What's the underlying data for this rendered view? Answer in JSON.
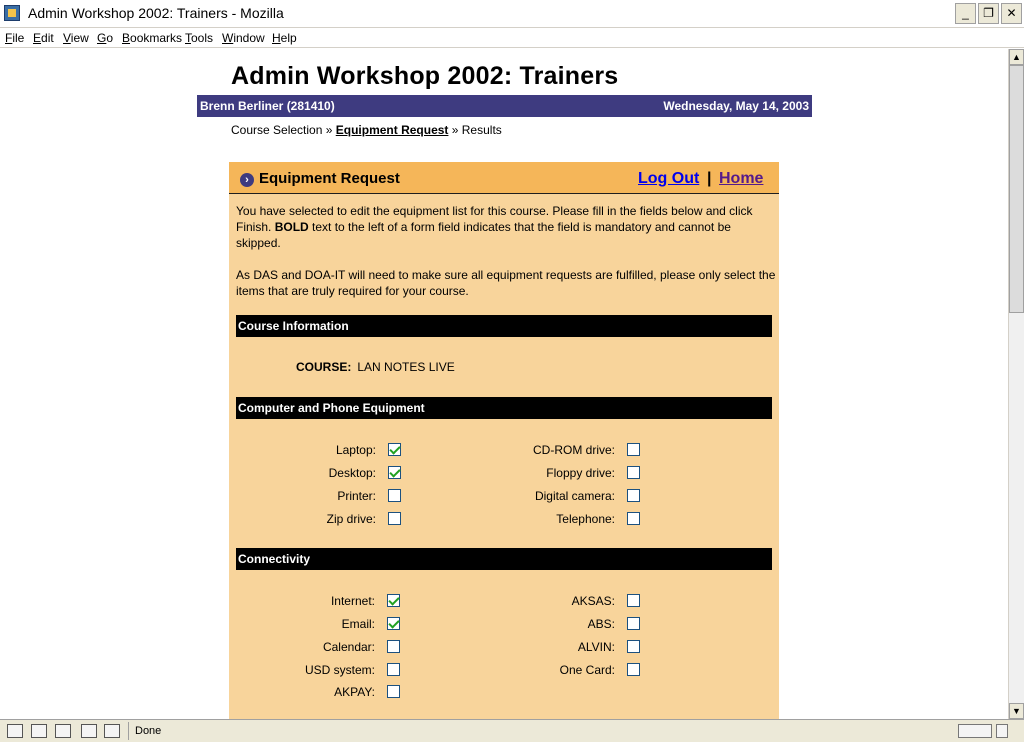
{
  "window": {
    "title": "Admin Workshop 2002: Trainers - Mozilla",
    "minimize": "_",
    "maximize": "❐",
    "close": "✕"
  },
  "menu": [
    "File",
    "Edit",
    "View",
    "Go",
    "Bookmarks",
    "Tools",
    "Window",
    "Help"
  ],
  "page": {
    "title": "Admin Workshop 2002: Trainers",
    "user": "Brenn Berliner (281410)",
    "date": "Wednesday, May 14, 2003",
    "breadcrumb": {
      "step1": "Course Selection",
      "sep1": " » ",
      "current": "Equipment Request",
      "sep2": " » ",
      "step3": "Results"
    }
  },
  "panel": {
    "title": "Equipment Request",
    "logout": "Log Out",
    "separator": "|",
    "home": "Home",
    "intro_a": "You have selected to edit the equipment list for this course. Please fill in the fields below and click Finish. ",
    "intro_bold": "BOLD",
    "intro_b": " text to the left of a form field indicates that the field is mandatory and cannot be skipped.",
    "das_note": "As DAS and DOA-IT will need to make sure all equipment requests are fulfilled, please only select the items that are truly required for your course."
  },
  "sections": {
    "course": "Course Information",
    "computer": "Computer and Phone Equipment",
    "connectivity": "Connectivity"
  },
  "course": {
    "label": "COURSE:",
    "value": "LAN NOTES LIVE"
  },
  "computer_items": [
    {
      "label": "Laptop:",
      "checked": true
    },
    {
      "label": "Desktop:",
      "checked": true
    },
    {
      "label": "Printer:",
      "checked": false
    },
    {
      "label": "Zip drive:",
      "checked": false
    },
    {
      "label": "CD-ROM drive:",
      "checked": false
    },
    {
      "label": "Floppy drive:",
      "checked": false
    },
    {
      "label": "Digital camera:",
      "checked": false
    },
    {
      "label": "Telephone:",
      "checked": false
    }
  ],
  "connectivity_items": [
    {
      "label": "Internet:",
      "checked": true
    },
    {
      "label": "Email:",
      "checked": true
    },
    {
      "label": "Calendar:",
      "checked": false
    },
    {
      "label": "USD system:",
      "checked": false
    },
    {
      "label": "AKPAY:",
      "checked": false
    },
    {
      "label": "AKSAS:",
      "checked": false
    },
    {
      "label": "ABS:",
      "checked": false
    },
    {
      "label": "ALVIN:",
      "checked": false
    },
    {
      "label": "One Card:",
      "checked": false
    }
  ],
  "status": {
    "text": "Done"
  },
  "icons": {
    "app": "mozilla-app-icon",
    "arrow": "circle-arrow-right-icon"
  }
}
